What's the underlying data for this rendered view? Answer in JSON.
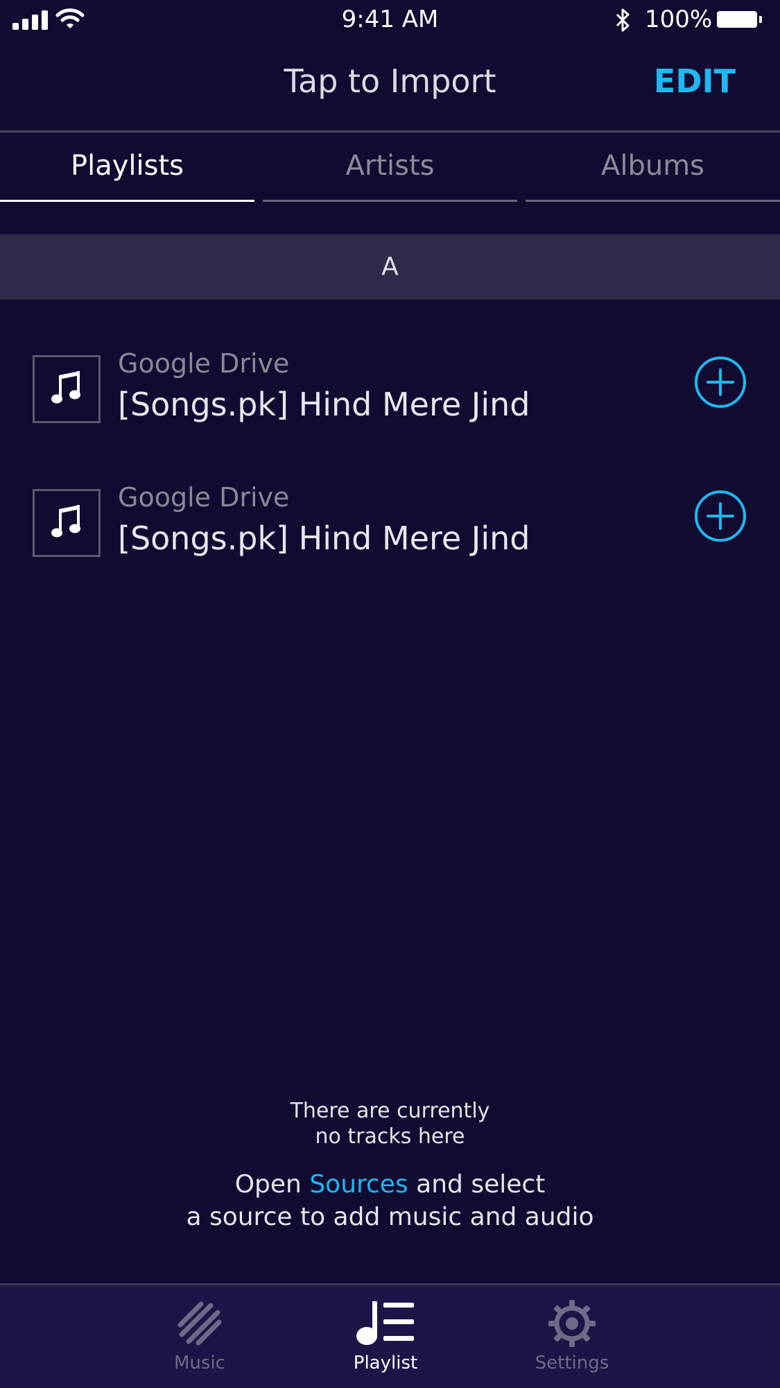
{
  "status_bar": {
    "time": "9:41 AM",
    "battery": "100%"
  },
  "header": {
    "title": "Tap to Import",
    "edit_label": "EDIT"
  },
  "tabs": [
    {
      "label": "Playlists",
      "active": true
    },
    {
      "label": "Artists",
      "active": false
    },
    {
      "label": "Albums",
      "active": false
    }
  ],
  "section": {
    "letter": "A"
  },
  "items": [
    {
      "source": "Google Drive",
      "title": "[Songs.pk] Hind Mere Jind",
      "icon": "music-note-icon",
      "action_icon": "plus-circle-icon"
    },
    {
      "source": "Google Drive",
      "title": "[Songs.pk] Hind Mere Jind",
      "icon": "music-note-icon",
      "action_icon": "plus-circle-icon"
    }
  ],
  "empty_state": {
    "line1": "There are currently",
    "line2": "no tracks here",
    "open_prefix": "Open ",
    "sources_link": "Sources",
    "open_suffix": " and select",
    "line4": "a source to add music and audio"
  },
  "bottom_nav": [
    {
      "label": "Music",
      "icon": "music-stripes-icon",
      "active": false
    },
    {
      "label": "Playlist",
      "icon": "playlist-icon",
      "active": true
    },
    {
      "label": "Settings",
      "icon": "gear-icon",
      "active": false
    }
  ],
  "colors": {
    "background": "#120b31",
    "accent": "#1fb8f0",
    "section_bg": "#2e2a4a",
    "tabbar_bg": "#1c1648"
  }
}
